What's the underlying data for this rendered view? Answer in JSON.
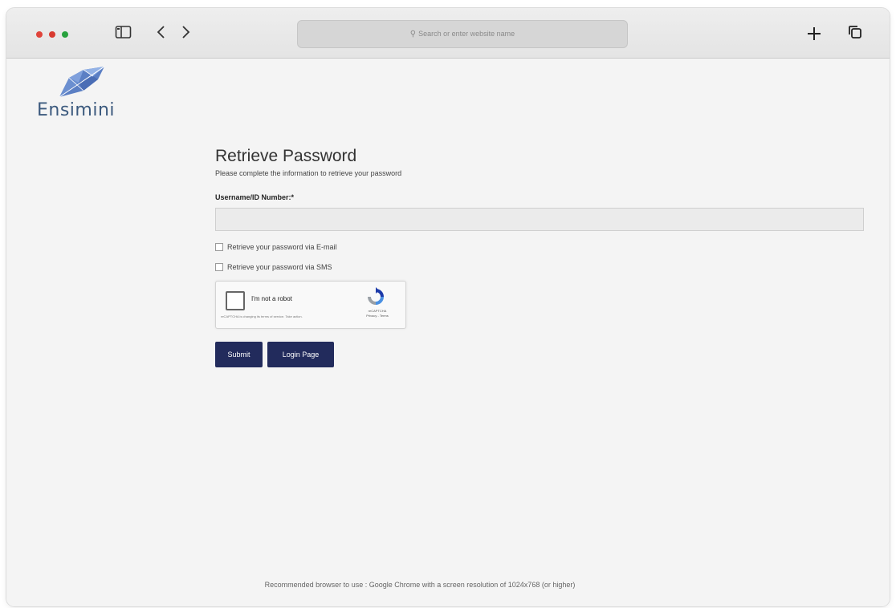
{
  "browser": {
    "address_placeholder": "Search or enter website name",
    "icons": {
      "sidebar": "sidebar-icon",
      "back": "chevron-left-icon",
      "forward": "chevron-right-icon",
      "search": "magnifier-icon",
      "new_tab": "plus-icon",
      "tabs": "tabs-overview-icon"
    }
  },
  "brand": {
    "name": "Ensimini",
    "color": "#3c5a7e"
  },
  "form": {
    "title": "Retrieve Password",
    "subtitle": "Please complete the information to retrieve your password",
    "username_label": "Username/ID Number:*",
    "username_value": "",
    "options": [
      {
        "label": "Retrieve your password via E-mail",
        "checked": false
      },
      {
        "label": "Retrieve your password via SMS",
        "checked": false
      }
    ],
    "captcha": {
      "label": "I'm not a robot",
      "note": "reCAPTCHA is changing its terms of service. Take action.",
      "brand": "reCAPTCHA",
      "links": "Privacy - Terms"
    },
    "submit_label": "Submit",
    "login_label": "Login Page",
    "button_color": "#222b5c"
  },
  "footer": {
    "text": "Recommended browser to use : Google Chrome with a screen resolution of 1024x768 (or higher)"
  }
}
